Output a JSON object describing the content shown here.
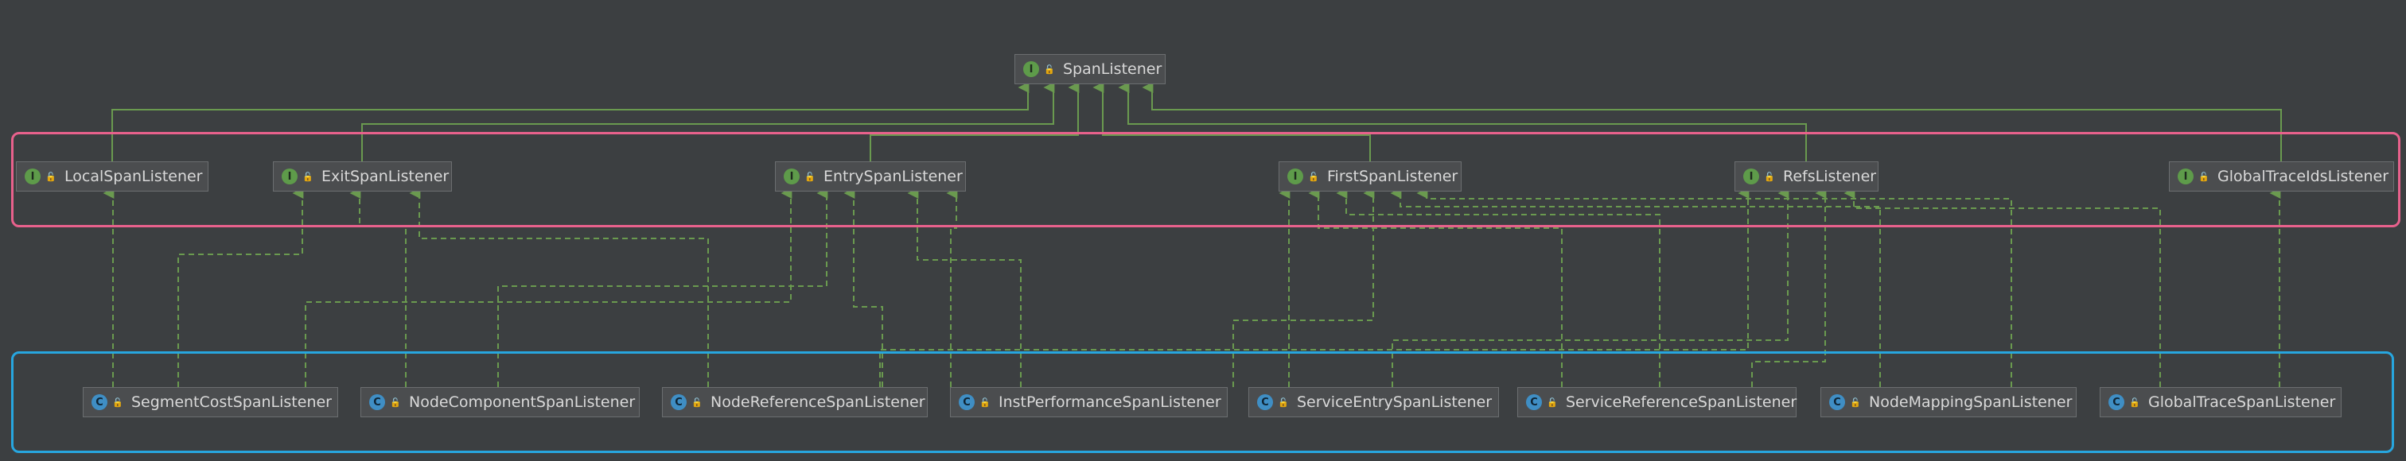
{
  "colors": {
    "background": "#3c3f41",
    "edge": "#6a9a4f",
    "interface_group_border": "#e8618c",
    "class_group_border": "#27a6df",
    "interface_badge": "#5e9b4a",
    "class_badge": "#3f8ec4"
  },
  "badge_letters": {
    "interface": "I",
    "class": "C"
  },
  "icons": {
    "interface": "interface-icon",
    "class": "class-icon",
    "visibility": "public-lock-icon"
  },
  "root": {
    "label": "SpanListener"
  },
  "interfaces": [
    {
      "label": "LocalSpanListener"
    },
    {
      "label": "ExitSpanListener"
    },
    {
      "label": "EntrySpanListener"
    },
    {
      "label": "FirstSpanListener"
    },
    {
      "label": "RefsListener"
    },
    {
      "label": "GlobalTraceIdsListener"
    }
  ],
  "classes": [
    {
      "label": "SegmentCostSpanListener"
    },
    {
      "label": "NodeComponentSpanListener"
    },
    {
      "label": "NodeReferenceSpanListener"
    },
    {
      "label": "InstPerformanceSpanListener"
    },
    {
      "label": "ServiceEntrySpanListener"
    },
    {
      "label": "ServiceReferenceSpanListener"
    },
    {
      "label": "NodeMappingSpanListener"
    },
    {
      "label": "GlobalTraceSpanListener"
    }
  ]
}
